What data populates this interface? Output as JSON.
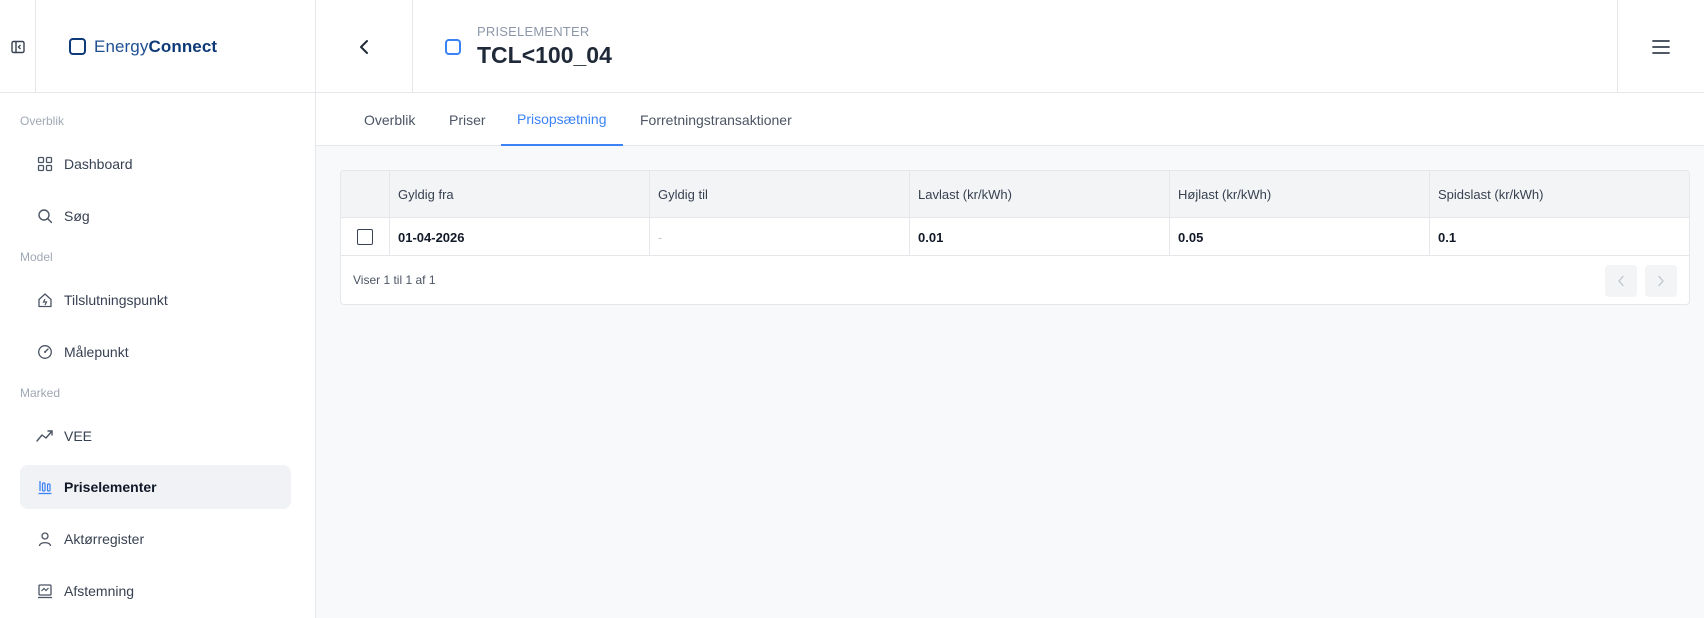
{
  "header": {
    "brand_light": "Energy",
    "brand_bold": "Connect",
    "entity_type": "PRISELEMENTER",
    "entity_title": "TCL<100_04"
  },
  "sidebar": {
    "sections": [
      "Overblik",
      "Model",
      "Marked"
    ],
    "items": [
      {
        "label": "Dashboard",
        "icon": "grid-icon"
      },
      {
        "label": "Søg",
        "icon": "search-icon"
      },
      {
        "label": "Tilslutningspunkt",
        "icon": "house-plug-icon"
      },
      {
        "label": "Målepunkt",
        "icon": "gauge-icon"
      },
      {
        "label": "VEE",
        "icon": "trend-icon"
      },
      {
        "label": "Priselementer",
        "icon": "price-bars-icon",
        "active": true
      },
      {
        "label": "Aktørregister",
        "icon": "user-icon"
      },
      {
        "label": "Afstemning",
        "icon": "reconcile-icon"
      }
    ]
  },
  "tabs": [
    {
      "label": "Overblik"
    },
    {
      "label": "Priser"
    },
    {
      "label": "Prisopsætning",
      "active": true
    },
    {
      "label": "Forretningstransaktioner"
    }
  ],
  "table": {
    "columns": [
      "Gyldig fra",
      "Gyldig til",
      "Lavlast (kr/kWh)",
      "Højlast (kr/kWh)",
      "Spidslast (kr/kWh)"
    ],
    "rows": [
      [
        "01-04-2026",
        "-",
        "0.01",
        "0.05",
        "0.1"
      ]
    ],
    "footer": "Viser 1 til 1 af 1"
  },
  "colors": {
    "accent": "#3b82f6",
    "brand": "#0e3a78"
  }
}
